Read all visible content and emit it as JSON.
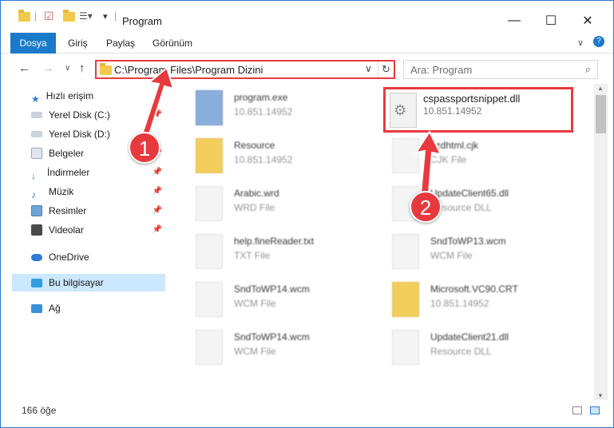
{
  "window": {
    "title": "Program",
    "minimize": "—",
    "maximize": "☐",
    "close": "✕"
  },
  "ribbon": {
    "tabs": [
      "Dosya",
      "Giriş",
      "Paylaş",
      "Görünüm"
    ]
  },
  "address": {
    "path": "C:\\Program Files\\Program Dizini",
    "search_placeholder": "Ara: Program"
  },
  "sidebar": {
    "items": [
      {
        "label": "Hızlı erişim",
        "icon": "star-icon"
      },
      {
        "label": "Yerel Disk (C:)",
        "icon": "drive-icon"
      },
      {
        "label": "Yerel Disk (D:)",
        "icon": "drive-icon"
      },
      {
        "label": "Belgeler",
        "icon": "documents-icon"
      },
      {
        "label": "İndirmeler",
        "icon": "download-icon"
      },
      {
        "label": "Müzik",
        "icon": "music-icon"
      },
      {
        "label": "Resimler",
        "icon": "pictures-icon"
      },
      {
        "label": "Videolar",
        "icon": "video-icon"
      },
      {
        "label": "OneDrive",
        "icon": "cloud-icon"
      },
      {
        "label": "Bu bilgisayar",
        "icon": "computer-icon"
      },
      {
        "label": "Ağ",
        "icon": "network-icon"
      }
    ]
  },
  "files": [
    {
      "name": "program.exe",
      "sub": "10.851.14952"
    },
    {
      "name": "cspassportsnippet.dll",
      "sub": "10.851.14952"
    },
    {
      "name": "Resource",
      "sub": "10.851.14952"
    },
    {
      "name": "ezdhtml.cjk",
      "sub": "CJK File"
    },
    {
      "name": "Arabic.wrd",
      "sub": "WRD File"
    },
    {
      "name": "UpdateClient65.dll",
      "sub": "Resource DLL"
    },
    {
      "name": "help.fineReader.txt",
      "sub": "TXT File"
    },
    {
      "name": "SndToWP13.wcm",
      "sub": "WCM File"
    },
    {
      "name": "SndToWP14.wcm",
      "sub": "WCM File"
    },
    {
      "name": "Microsoft.VC90.CRT",
      "sub": "10.851.14952"
    },
    {
      "name": "SndToWP14.wcm",
      "sub": "WCM File"
    },
    {
      "name": "UpdateClient21.dll",
      "sub": "Resource DLL"
    }
  ],
  "status": {
    "count": "166 öğe"
  },
  "annotations": {
    "badge1": "1",
    "badge2": "2",
    "color": "#e8393f"
  }
}
